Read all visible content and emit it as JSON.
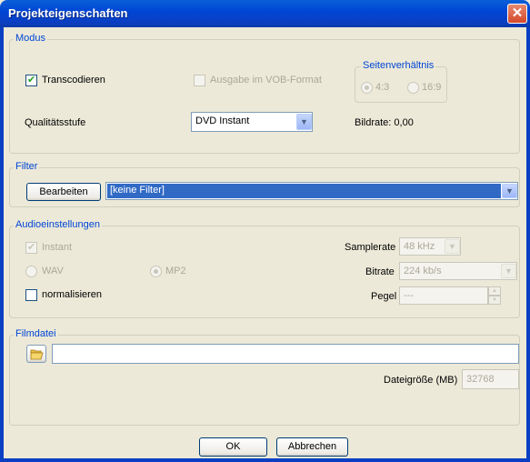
{
  "window": {
    "title": "Projekteigenschaften",
    "close_glyph": "✕"
  },
  "modus": {
    "legend": "Modus",
    "transcode_label": "Transcodieren",
    "transcode_checked": true,
    "vob_label": "Ausgabe im VOB-Format",
    "vob_checked": false,
    "aspect_legend": "Seitenverhältnis",
    "aspect_43": "4:3",
    "aspect_169": "16:9",
    "aspect_selected": "4:3",
    "quality_label": "Qualitätsstufe",
    "quality_value": "DVD Instant",
    "bitrate_text": "Bildrate: 0,00"
  },
  "filter": {
    "legend": "Filter",
    "edit_button": "Bearbeiten",
    "value": "[keine Filter]"
  },
  "audio": {
    "legend": "Audioeinstellungen",
    "instant_label": "Instant",
    "instant_checked": true,
    "wav_label": "WAV",
    "mp2_label": "MP2",
    "format_selected": "MP2",
    "normalize_label": "normalisieren",
    "normalize_checked": false,
    "samplerate_label": "Samplerate",
    "samplerate_value": "48 kHz",
    "bitrate_label": "Bitrate",
    "bitrate_value": "224 kb/s",
    "level_label": "Pegel",
    "level_value": "---"
  },
  "movie": {
    "legend": "Filmdatei",
    "path_value": "",
    "size_label": "Dateigröße (MB)",
    "size_value": "32768"
  },
  "buttons": {
    "ok": "OK",
    "cancel": "Abbrechen"
  },
  "icons": {
    "folder": "folder-open-icon",
    "dropdown": "chevron-down-icon"
  },
  "colors": {
    "titlebar": "#0046d5",
    "legend_text": "#0046d5",
    "selection": "#316ac5",
    "dialog_bg": "#ece9d8"
  }
}
